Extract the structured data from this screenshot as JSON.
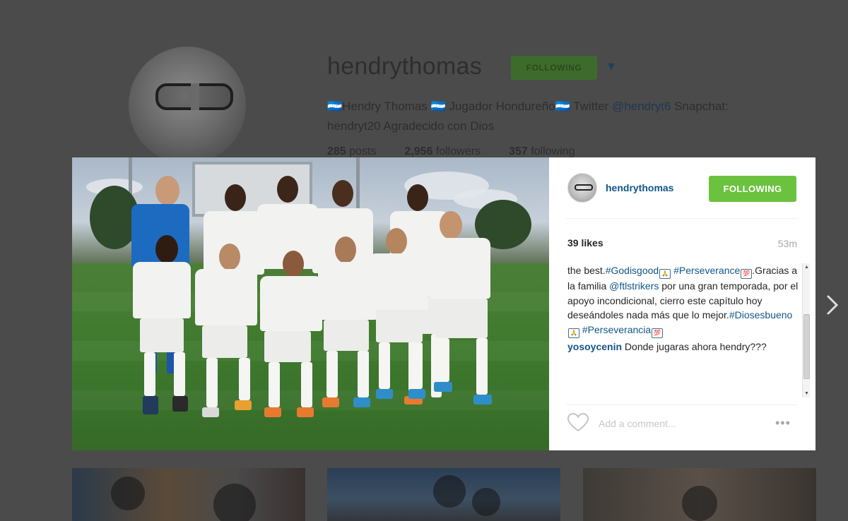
{
  "profile": {
    "username": "hendrythomas",
    "follow_label": "FOLLOWING",
    "caret": "▼",
    "bio_line1": "🇭🇳Hendry Thomas 🇭🇳 Jugador Hondureño🇭🇳 Twitter ",
    "bio_twitter": "@hendryt6",
    "bio_line1_tail": " Snapchat:",
    "bio_line2": "hendryt20 Agradecido con Dios",
    "posts_count": "285",
    "posts_label": "posts",
    "followers_count": "2,956",
    "followers_label": "followers",
    "following_count": "357",
    "following_label": "following"
  },
  "modal": {
    "username": "hendrythomas",
    "follow_label": "FOLLOWING",
    "likes": "39 likes",
    "time": "53m",
    "caption": {
      "part1": "the best.",
      "tag1": "#Godisgood",
      "tag2": "#Perseverance",
      "part2": ".Gracias a la familia ",
      "mention": "@ftlstrikers",
      "part3": " por una gran temporada, por el apoyo incondicional, cierro este capítulo hoy deseándoles nada más que lo mejor.",
      "tag3": "#Diosesbueno",
      "tag4": "#Perseverancia"
    },
    "emoji_pray": "🙏",
    "emoji_100": "💯",
    "comment": {
      "author": "yosoycenin",
      "text": " Donde jugaras ahora hendry???"
    },
    "comment_placeholder": "Add a comment...",
    "more_label": "•••"
  },
  "icons": {
    "heart": "heart-icon",
    "next": "chevron-right-icon",
    "more": "more-options-icon"
  },
  "colors": {
    "link": "#125688",
    "follow_green": "#6bc23f",
    "overlay": "#4b4b4b"
  }
}
